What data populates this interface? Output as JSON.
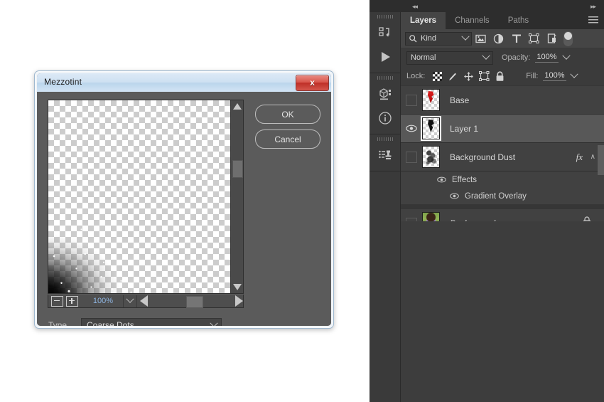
{
  "dialog": {
    "title": "Mezzotint",
    "close_label": "x",
    "buttons": {
      "ok": "OK",
      "cancel": "Cancel"
    },
    "zoom": {
      "value": "100%",
      "minus": "−",
      "plus": "+"
    },
    "type": {
      "label": "Type",
      "value": "Coarse Dots"
    }
  },
  "dock": {
    "collapse_left": "◂◂",
    "collapse_right": "▸▸",
    "rail_icons": [
      {
        "name": "history-icon"
      },
      {
        "name": "play-icon"
      },
      {
        "name": "3d-icon"
      },
      {
        "name": "info-icon"
      },
      {
        "name": "clone-source-icon"
      }
    ],
    "tabs": [
      {
        "label": "Layers",
        "active": true
      },
      {
        "label": "Channels",
        "active": false
      },
      {
        "label": "Paths",
        "active": false
      }
    ],
    "filter": {
      "kind": "Kind",
      "icons": [
        "pixel-filter-icon",
        "adjustment-filter-icon",
        "type-filter-icon",
        "shape-filter-icon",
        "smart-object-filter-icon"
      ]
    },
    "blend": {
      "mode": "Normal",
      "opacity_label": "Opacity:",
      "opacity_value": "100%"
    },
    "lock": {
      "label": "Lock:",
      "icons": [
        "lock-transparent-pixels-icon",
        "lock-image-pixels-icon",
        "lock-position-icon",
        "lock-artboard-icon",
        "lock-all-icon"
      ],
      "fill_label": "Fill:",
      "fill_value": "100%"
    },
    "layers": [
      {
        "name": "Base",
        "visible": false,
        "selected": false,
        "italic": false,
        "fx": false,
        "locked": false,
        "thumb": "art-base"
      },
      {
        "name": "Layer 1",
        "visible": true,
        "selected": true,
        "italic": false,
        "fx": false,
        "locked": false,
        "thumb": "art-layer1"
      },
      {
        "name": "Background Dust",
        "visible": false,
        "selected": false,
        "italic": false,
        "fx": true,
        "fx_label": "fx",
        "collapse": "∧",
        "locked": false,
        "thumb": "art-dust"
      }
    ],
    "effects": [
      {
        "name": "Effects",
        "visible": true,
        "indent": 0
      },
      {
        "name": "Gradient Overlay",
        "visible": true,
        "indent": 1
      }
    ],
    "background_layer": {
      "name": "Background",
      "visible": false,
      "selected": false,
      "italic": true,
      "locked": true,
      "thumb": "art-photo"
    }
  }
}
